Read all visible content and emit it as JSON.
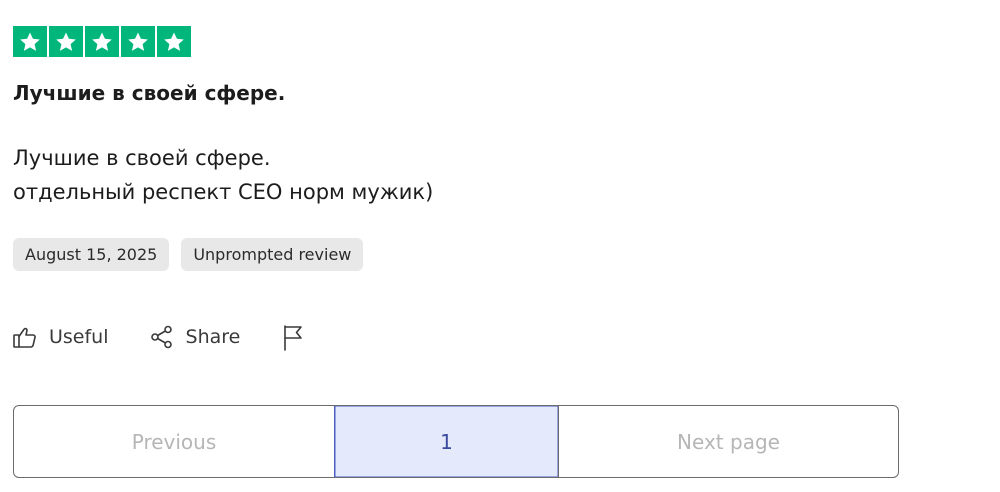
{
  "review": {
    "rating": 5,
    "star_color": "#00b67a",
    "title": "Лучшие в своей сфере.",
    "body_lines": [
      "Лучшие в своей сфере.",
      "отдельный респект CEO норм мужик)"
    ],
    "date": "August 15, 2025",
    "tag": "Unprompted review"
  },
  "actions": {
    "useful_label": "Useful",
    "share_label": "Share",
    "useful_icon": "thumbs-up-icon",
    "share_icon": "share-icon",
    "report_icon": "flag-icon"
  },
  "pagination": {
    "previous_label": "Previous",
    "current_page": "1",
    "next_label": "Next page",
    "accent_color": "#e4e9fc"
  }
}
